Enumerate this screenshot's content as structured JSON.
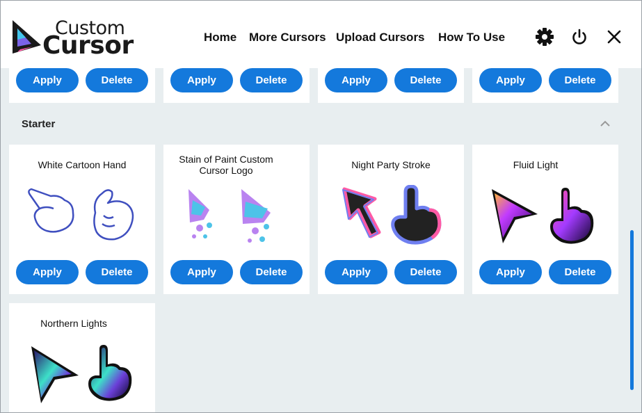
{
  "header": {
    "logo_line1": "Custom",
    "logo_line2": "Cursor",
    "nav": [
      "Home",
      "More Cursors",
      "Upload Cursors",
      "How To Use"
    ]
  },
  "buttons": {
    "apply": "Apply",
    "delete": "Delete"
  },
  "section": {
    "title": "Starter"
  },
  "cards": [
    {
      "title": "White Cartoon Hand"
    },
    {
      "title": "Stain of Paint Custom Cursor Logo",
      "line1": "Stain of Paint Custom",
      "line2": "Cursor Logo"
    },
    {
      "title": "Night Party Stroke"
    },
    {
      "title": "Fluid Light"
    },
    {
      "title": "Northern Lights"
    }
  ],
  "colors": {
    "accent": "#1479dc",
    "background": "#e8eef0"
  },
  "icons": [
    "settings-gear-icon",
    "power-icon",
    "close-icon",
    "chevron-up-icon"
  ]
}
